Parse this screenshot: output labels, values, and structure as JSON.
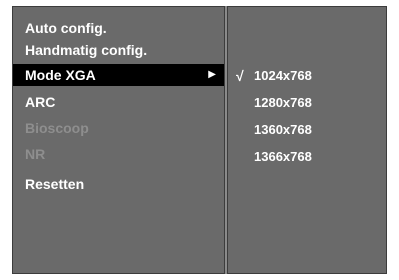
{
  "menu": {
    "items": [
      {
        "label": "Auto config.",
        "state": "normal"
      },
      {
        "label": "Handmatig config.",
        "state": "normal"
      },
      {
        "label": "Mode XGA",
        "state": "selected",
        "arrow": "▶"
      },
      {
        "label": "ARC",
        "state": "normal"
      },
      {
        "label": "Bioscoop",
        "state": "disabled"
      },
      {
        "label": "NR",
        "state": "disabled"
      },
      {
        "label": "Resetten",
        "state": "normal"
      }
    ]
  },
  "submenu": {
    "check_mark": "√",
    "options": [
      {
        "label": "1024x768",
        "checked": true
      },
      {
        "label": "1280x768",
        "checked": false
      },
      {
        "label": "1360x768",
        "checked": false
      },
      {
        "label": "1366x768",
        "checked": false
      }
    ]
  },
  "colors": {
    "panel": "#6a6a6a",
    "selected_bg": "#000000",
    "text": "#ffffff",
    "disabled_text": "#8e8e8e"
  }
}
